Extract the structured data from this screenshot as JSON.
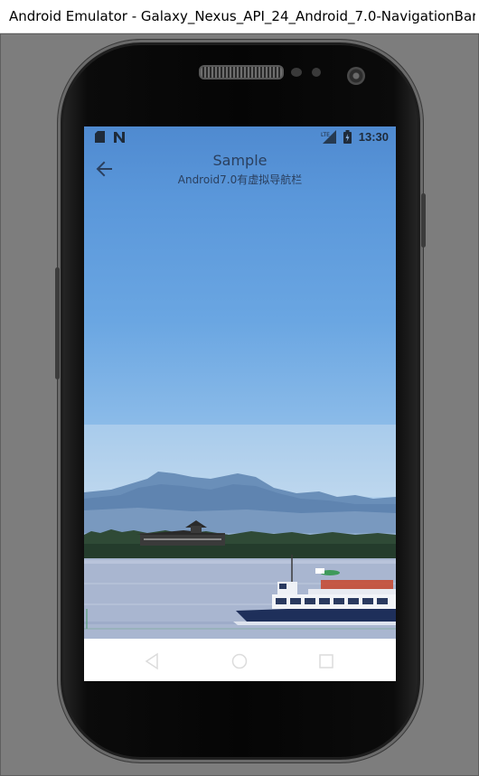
{
  "window": {
    "title": "Android Emulator - Galaxy_Nexus_API_24_Android_7.0-NavigationBar:5554"
  },
  "status_bar": {
    "time": "13:30",
    "left_icons": [
      "sd-card-icon",
      "n-notification-icon"
    ],
    "right_icons": [
      "signal-icon",
      "battery-icon"
    ]
  },
  "toolbar": {
    "title": "Sample",
    "subtitle": "Android7.0有虚拟导航栏",
    "back_icon": "arrow-back-icon"
  },
  "nav_bar": {
    "buttons": [
      "back-triangle-icon",
      "home-circle-icon",
      "recents-square-icon"
    ]
  },
  "colors": {
    "sky_top": "#4f8ad0",
    "sky_bottom": "#c6dbef",
    "toolbar_text": "#2a3f5e",
    "emulator_background": "#7d7d7d",
    "nav_bar": "#ffffff"
  }
}
